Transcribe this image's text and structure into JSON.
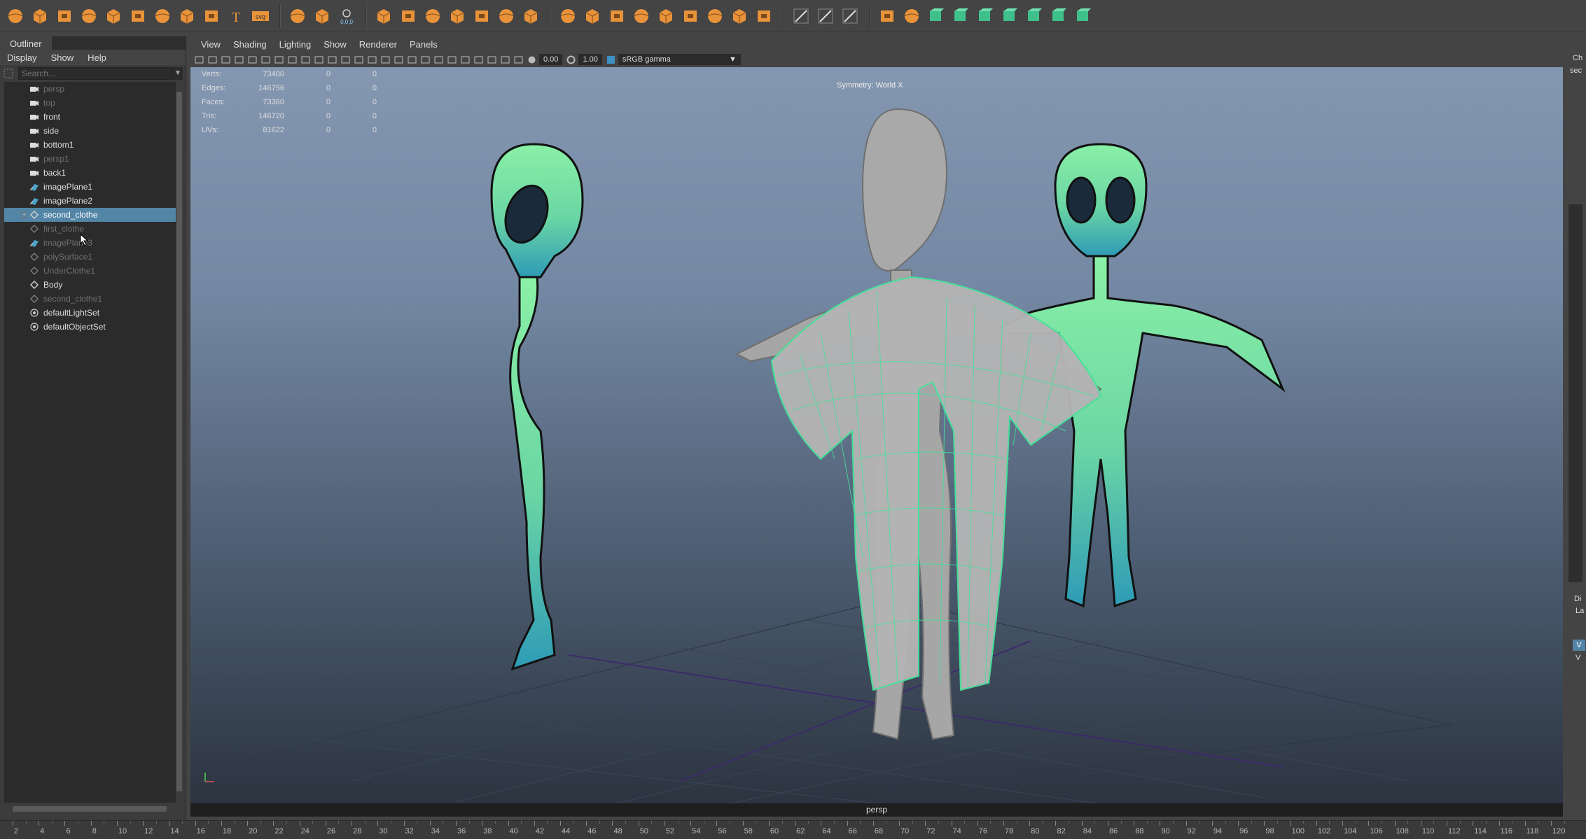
{
  "shelf": {
    "icons": [
      "sphere-icon",
      "cube-icon",
      "cylinder-icon",
      "cone-icon",
      "torus-icon",
      "plane-icon",
      "disc-icon",
      "platonic-icon",
      "sweep-icon",
      "text-icon",
      "svg-icon",
      "sep",
      "measure-icon",
      "locator-icon",
      "coordinate-icon",
      "sep",
      "combine-icon",
      "separate-icon",
      "extract-icon",
      "smooth-icon",
      "reduce-icon",
      "cleanup-icon",
      "mirror-icon",
      "sep",
      "boolean-union-icon",
      "boolean-difference-icon",
      "bevel-icon",
      "bridge-icon",
      "extrude-icon",
      "fill-hole-icon",
      "append-icon",
      "poke-icon",
      "wedge-icon",
      "sep",
      "multicut-icon",
      "target-weld-icon",
      "quad-draw-icon",
      "sep",
      "uv-editor-icon",
      "planar-map-icon",
      "cylindrical-map-icon",
      "spherical-map-icon",
      "automatic-map-icon",
      "unfold-icon",
      "layout-uv-icon",
      "cut-uv-icon",
      "sew-uv-icon"
    ],
    "svg_label": "svg",
    "coord_label": "0,0,0"
  },
  "outliner": {
    "title": "Outliner",
    "menu": [
      "Display",
      "Show",
      "Help"
    ],
    "search_placeholder": "Search...",
    "items": [
      {
        "label": "persp",
        "type": "camera",
        "dim": true
      },
      {
        "label": "top",
        "type": "camera",
        "dim": true
      },
      {
        "label": "front",
        "type": "camera",
        "dim": false
      },
      {
        "label": "side",
        "type": "camera",
        "dim": false
      },
      {
        "label": "bottom1",
        "type": "camera",
        "dim": false
      },
      {
        "label": "persp1",
        "type": "camera",
        "dim": true
      },
      {
        "label": "back1",
        "type": "camera",
        "dim": false
      },
      {
        "label": "imagePlane1",
        "type": "imageplane",
        "dim": false
      },
      {
        "label": "imagePlane2",
        "type": "imageplane",
        "dim": false
      },
      {
        "label": "second_clothe",
        "type": "mesh",
        "dim": false,
        "selected": true,
        "expandable": true
      },
      {
        "label": "first_clothe",
        "type": "mesh",
        "dim": true
      },
      {
        "label": "imagePlane3",
        "type": "imageplane",
        "dim": true
      },
      {
        "label": "polySurface1",
        "type": "mesh",
        "dim": true
      },
      {
        "label": "UnderClothe1",
        "type": "mesh",
        "dim": true
      },
      {
        "label": "Body",
        "type": "mesh",
        "dim": false
      },
      {
        "label": "second_clothe1",
        "type": "mesh",
        "dim": true
      },
      {
        "label": "defaultLightSet",
        "type": "set",
        "dim": false
      },
      {
        "label": "defaultObjectSet",
        "type": "set",
        "dim": false
      }
    ]
  },
  "panel": {
    "menu": [
      "View",
      "Shading",
      "Lighting",
      "Show",
      "Renderer",
      "Panels"
    ],
    "exposure": "0.00",
    "gamma": "1.00",
    "colorspace": "sRGB gamma"
  },
  "hud": {
    "rows": [
      {
        "label": "Verts:",
        "value": "73400",
        "c1": "0",
        "c2": "0"
      },
      {
        "label": "Edges:",
        "value": "146756",
        "c1": "0",
        "c2": "0"
      },
      {
        "label": "Faces:",
        "value": "73360",
        "c1": "0",
        "c2": "0"
      },
      {
        "label": "Tris:",
        "value": "146720",
        "c1": "0",
        "c2": "0"
      },
      {
        "label": "UVs:",
        "value": "81622",
        "c1": "0",
        "c2": "0"
      }
    ],
    "symmetry": "Symmetry: World X",
    "camera": "persp"
  },
  "right_strip": {
    "t1": "Ch",
    "t2": "sec",
    "t3": "Di",
    "t4": "La",
    "vbtn": "V",
    "t5": "V"
  },
  "timeline": {
    "ticks": [
      "2",
      "4",
      "6",
      "8",
      "10",
      "12",
      "14",
      "16",
      "18",
      "20",
      "22",
      "24",
      "26",
      "28",
      "30",
      "32",
      "34",
      "36",
      "38",
      "40",
      "42",
      "44",
      "46",
      "48",
      "50",
      "52",
      "54",
      "56",
      "58",
      "60",
      "62",
      "64",
      "66",
      "68",
      "70",
      "72",
      "74",
      "76",
      "78",
      "80",
      "82",
      "84",
      "86",
      "88",
      "90",
      "92",
      "94",
      "96",
      "98",
      "100",
      "102",
      "104",
      "106",
      "108",
      "110",
      "112",
      "114",
      "116",
      "118",
      "120"
    ]
  },
  "colors": {
    "accent": "#5285a6",
    "alien_green": "#7be3a0",
    "shelf_orange": "#e8923a",
    "wire": "#45e29a"
  }
}
